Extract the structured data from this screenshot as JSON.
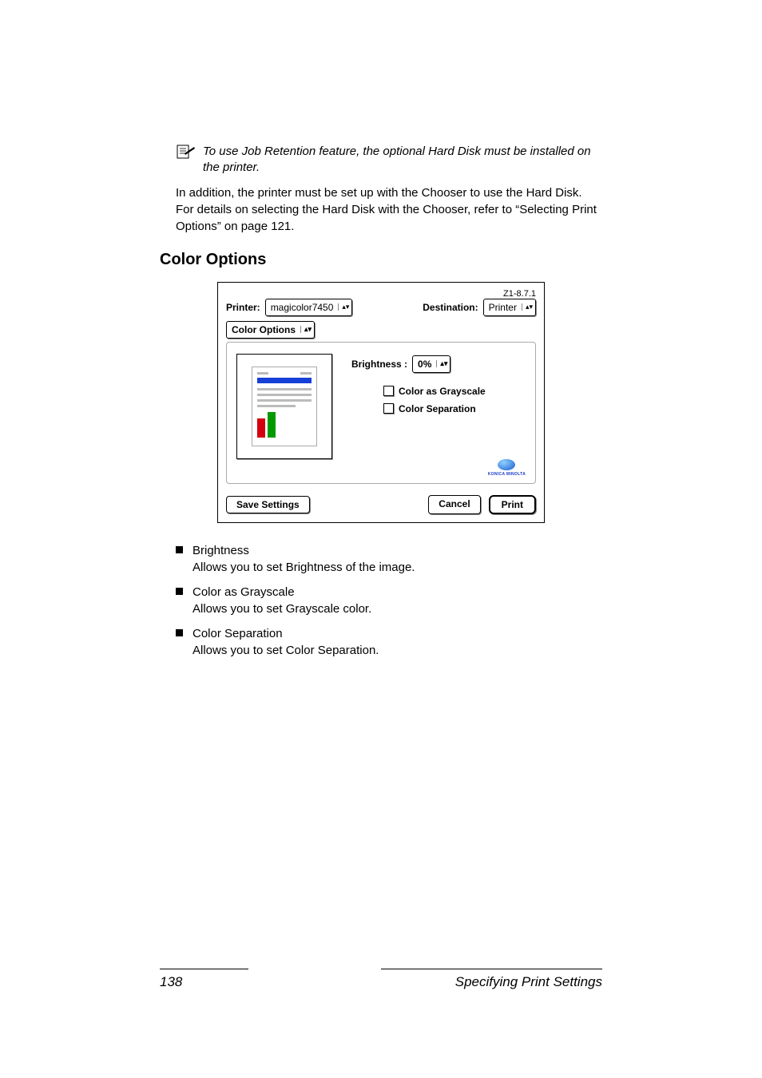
{
  "note_text": "To use Job Retention feature, the optional Hard Disk must be installed on the printer.",
  "body_text": "In addition, the printer must be set up with the Chooser to use the Hard Disk. For details on selecting the Hard Disk with the Chooser, refer to “Selecting Print Options” on page 121.",
  "heading": "Color Options",
  "dialog": {
    "version": "Z1-8.7.1",
    "printer_label": "Printer:",
    "printer_value": "magicolor7450",
    "destination_label": "Destination:",
    "destination_value": "Printer",
    "panel_select": "Color Options",
    "brightness_label": "Brightness :",
    "brightness_value": "0%",
    "chk_grayscale": "Color as Grayscale",
    "chk_separation": "Color Separation",
    "logo_text": "KONICA MINOLTA",
    "save_btn": "Save Settings",
    "cancel_btn": "Cancel",
    "print_btn": "Print"
  },
  "bullets": [
    {
      "title": "Brightness",
      "desc": "Allows you to set Brightness of the image."
    },
    {
      "title": "Color as Grayscale",
      "desc": "Allows you to set Grayscale color."
    },
    {
      "title": "Color Separation",
      "desc": "Allows you to set Color Separation."
    }
  ],
  "footer": {
    "page": "138",
    "section": "Specifying Print Settings"
  }
}
